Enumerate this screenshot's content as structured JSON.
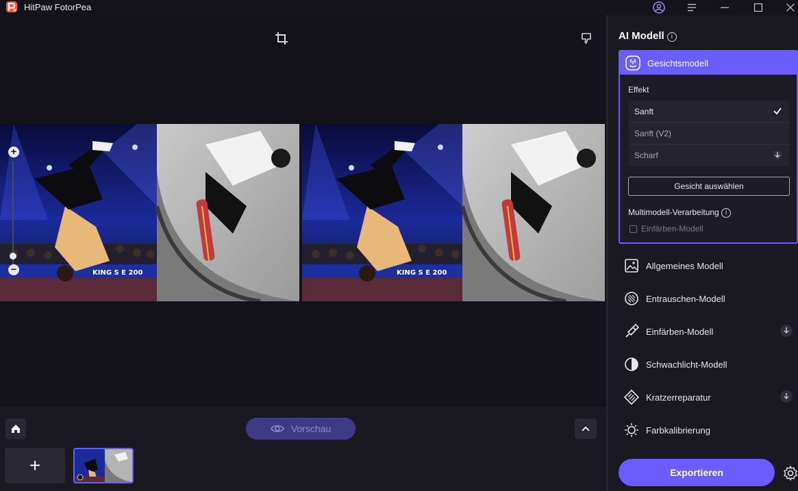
{
  "app": {
    "title": "HitPaw FotorPea"
  },
  "canvas": {
    "zoom_in_label": "+",
    "zoom_out_label": "−"
  },
  "bottom": {
    "preview_label": "Vorschau",
    "add_label": "+"
  },
  "panel": {
    "title": "AI Modell",
    "info": "i",
    "active_model": {
      "label": "Gesichtsmodell",
      "effect_title": "Effekt",
      "effects": [
        {
          "label": "Sanft"
        },
        {
          "label": "Sanft (V2)"
        },
        {
          "label": "Scharf"
        }
      ],
      "select_face_label": "Gesicht auswählen",
      "multi_label": "Multimodell-Verarbeitung",
      "multi_option": "Einfärben-Modell"
    },
    "models": [
      {
        "label": "Allgemeines Modell",
        "icon": "image-icon"
      },
      {
        "label": "Entrauschen-Modell",
        "icon": "denoise-icon"
      },
      {
        "label": "Einfärben-Modell",
        "icon": "colorize-icon"
      },
      {
        "label": "Schwachlicht-Modell",
        "icon": "lowlight-icon"
      },
      {
        "label": "Kratzerreparatur",
        "icon": "scratch-icon"
      },
      {
        "label": "Farbkalibrierung",
        "icon": "sun-icon"
      }
    ],
    "export_label": "Exportieren"
  },
  "colors": {
    "accent": "#6a5cff",
    "background": "#13121a",
    "panel": "#1a1922"
  }
}
